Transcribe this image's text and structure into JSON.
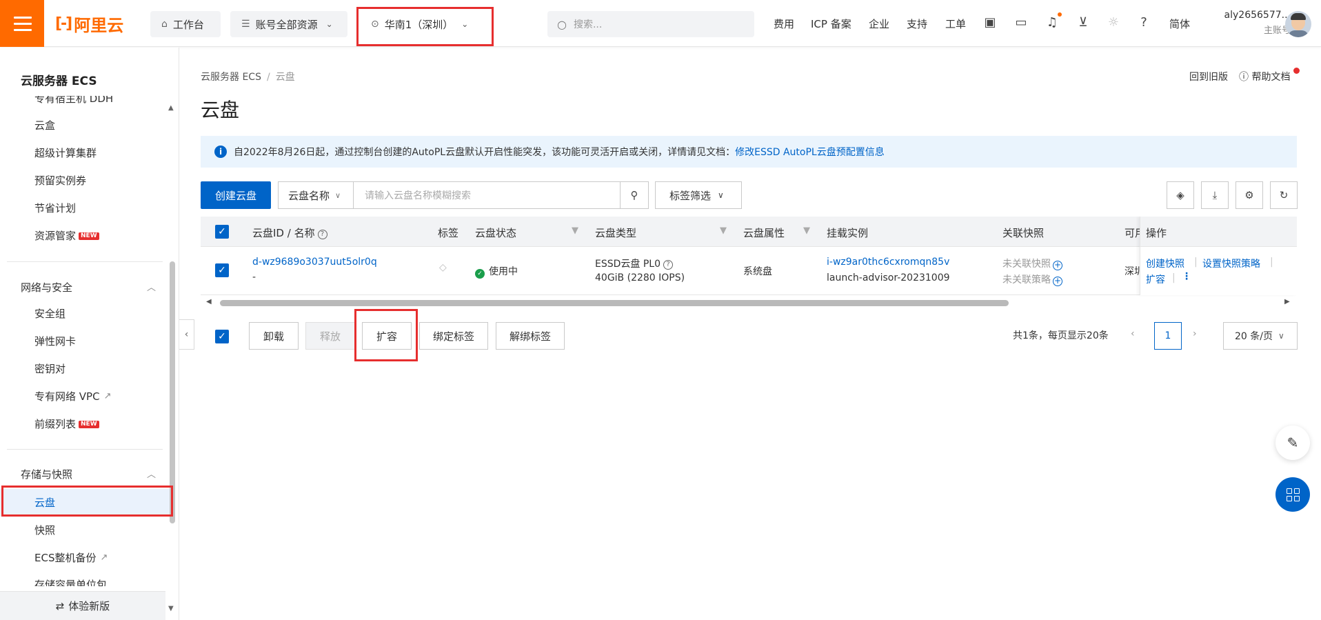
{
  "header": {
    "logo_text": "阿里云",
    "workbench": "工作台",
    "resources": "账号全部资源",
    "region": "华南1（深圳）",
    "search_placeholder": "搜索...",
    "links": [
      "费用",
      "ICP 备案",
      "企业",
      "支持",
      "工单"
    ],
    "language": "简体",
    "username": "aly2656577...",
    "role": "主账号"
  },
  "sidebar": {
    "title": "云服务器 ECS",
    "items_top": [
      {
        "label": "专有宿主机 DDH"
      },
      {
        "label": "云盒"
      },
      {
        "label": "超级计算集群"
      },
      {
        "label": "预留实例券"
      },
      {
        "label": "节省计划"
      },
      {
        "label": "资源管家",
        "badge": "NEW"
      }
    ],
    "group_network": "网络与安全",
    "items_network": [
      {
        "label": "安全组"
      },
      {
        "label": "弹性网卡"
      },
      {
        "label": "密钥对"
      },
      {
        "label": "专有网络 VPC",
        "external": true
      },
      {
        "label": "前缀列表",
        "badge": "NEW"
      }
    ],
    "group_storage": "存储与快照",
    "items_storage": [
      {
        "label": "云盘",
        "active": true
      },
      {
        "label": "快照"
      },
      {
        "label": "ECS整机备份",
        "external": true
      },
      {
        "label": "存储容量单位包"
      }
    ],
    "footer": "体验新版"
  },
  "page": {
    "breadcrumb": [
      "云服务器 ECS",
      "云盘"
    ],
    "title": "云盘",
    "back_old": "回到旧版",
    "help_doc": "帮助文档",
    "notice_text": "自2022年8月26日起，通过控制台创建的AutoPL云盘默认开启性能突发，该功能可灵活开启或关闭，详情请见文档：",
    "notice_link": "修改ESSD AutoPL云盘预配置信息"
  },
  "toolbar": {
    "create": "创建云盘",
    "field_select": "云盘名称",
    "search_placeholder": "请输入云盘名称模糊搜索",
    "tag_filter": "标签筛选"
  },
  "table": {
    "headers": {
      "id": "云盘ID / 名称",
      "tag": "标签",
      "status": "云盘状态",
      "type": "云盘类型",
      "attr": "云盘属性",
      "instance": "挂载实例",
      "snapshot": "关联快照",
      "zone": "可用",
      "ops": "操作"
    },
    "rows": [
      {
        "id": "d-wz9689o3037uut5olr0q",
        "name": "-",
        "status": "使用中",
        "type": "ESSD云盘 PL0",
        "type_spec": "40GiB (2280 IOPS)",
        "attr": "系统盘",
        "instance_id": "i-wz9ar0thc6cxromqn85v",
        "instance_name": "launch-advisor-20231009",
        "snapshot": "未关联快照",
        "policy": "未关联策略",
        "zone": "深圳",
        "ops": [
          "创建快照",
          "设置快照策略",
          "扩容"
        ]
      }
    ]
  },
  "bulk": {
    "unmount": "卸载",
    "release": "释放",
    "expand": "扩容",
    "bind_tag": "绑定标签",
    "unbind_tag": "解绑标签"
  },
  "pager": {
    "summary": "共1条，每页显示20条",
    "current": "1",
    "size": "20 条/页"
  },
  "colors": {
    "brand": "#ff6a00",
    "primary": "#0064c8",
    "highlight": "#e62e2e"
  }
}
